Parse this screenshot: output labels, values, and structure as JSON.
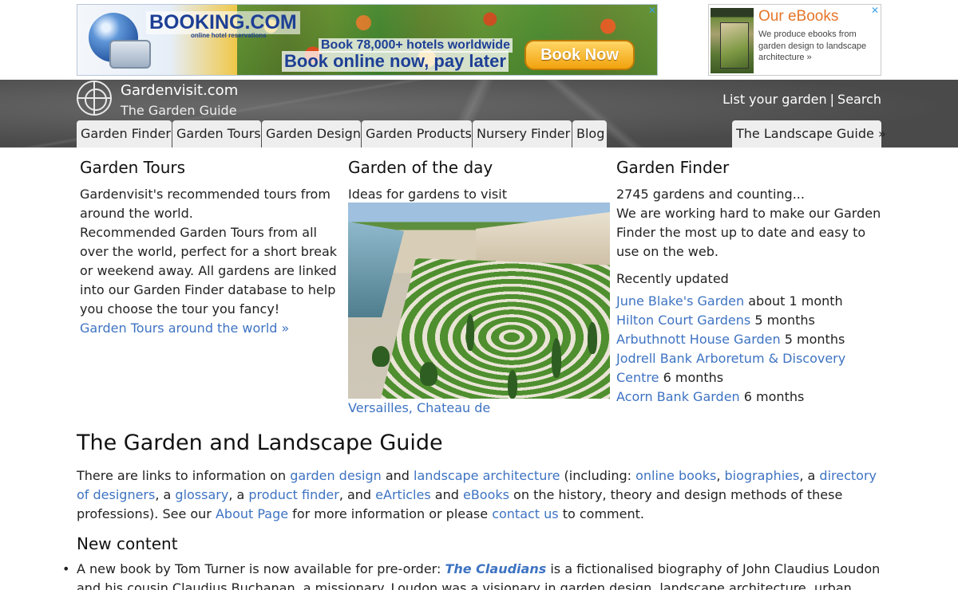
{
  "ads": {
    "booking": {
      "brand": "BOOKING.COM",
      "brand_sub": "online hotel reservations",
      "line1": "Book 78,000+ hotels worldwide",
      "line2": "Book online now, pay later",
      "cta": "Book Now"
    },
    "ebooks": {
      "title": "Our eBooks",
      "desc": "We produce ebooks from garden design to landscape architecture »"
    },
    "close_glyph": "✕"
  },
  "header": {
    "site_name": "Gardenvisit.com",
    "tagline": "The Garden Guide",
    "list_link": "List your garden",
    "separator": "|",
    "search_link": "Search"
  },
  "nav": {
    "tabs": [
      "Garden Finder",
      "Garden Tours",
      "Garden Design",
      "Garden Products",
      "Nursery Finder",
      "Blog"
    ],
    "right_tab": "The Landscape Guide »"
  },
  "tours": {
    "title": "Garden Tours",
    "p1": "Gardenvisit's recommended tours from around the world.",
    "p2": "Recommended Garden Tours from all over the world, perfect for a short break or weekend away. All gardens are linked into our Garden Finder database to help you choose the tour you fancy!",
    "link": "Garden Tours around the world »"
  },
  "garden_of_day": {
    "title": "Garden of the day",
    "subtitle": "Ideas for gardens to visit",
    "caption": "Versailles, Chateau de"
  },
  "finder": {
    "title": "Garden Finder",
    "count": "2745 gardens and counting...",
    "desc": "We are working hard to make our Garden Finder the most up to date and easy to use on the web.",
    "recent_label": "Recently updated",
    "recent": [
      {
        "name": "June Blake's Garden",
        "age": "about 1 month"
      },
      {
        "name": "Hilton Court Gardens",
        "age": "5 months"
      },
      {
        "name": "Arbuthnott House Garden",
        "age": "5 months"
      },
      {
        "name": "Jodrell Bank Arboretum & Discovery Centre",
        "age": "6 months"
      },
      {
        "name": "Acorn Bank Garden",
        "age": "6 months"
      }
    ]
  },
  "main": {
    "title": "The Garden and Landscape Guide",
    "intro": {
      "t1": "There are links to information on ",
      "l1": "garden design",
      "t2": " and ",
      "l2": "landscape architecture",
      "t3": " (including: ",
      "l3": "online books",
      "t4": ", ",
      "l4": "biographies",
      "t5": ", a ",
      "l5": "directory of designers",
      "t6": ", a ",
      "l6": "glossary",
      "t7": ", a ",
      "l7": "product finder",
      "t8": ", and ",
      "l8": "eArticles",
      "t9": " and ",
      "l9": "eBooks",
      "t10": " on the history, theory and design methods of these professions). See our ",
      "l10": "About Page",
      "t11": " for more information or please ",
      "l11": "contact us",
      "t12": " to comment."
    },
    "new_content_title": "New content",
    "news": {
      "t1": "A new book by Tom Turner is now available for pre-order: ",
      "book": "The Claudians",
      "t2": " is a fictionalised biography of John Claudius Loudon and his cousin Claudius Buchanan, a missionary. Loudon was a visionary in garden design, landscape architecture, urban design and"
    }
  }
}
